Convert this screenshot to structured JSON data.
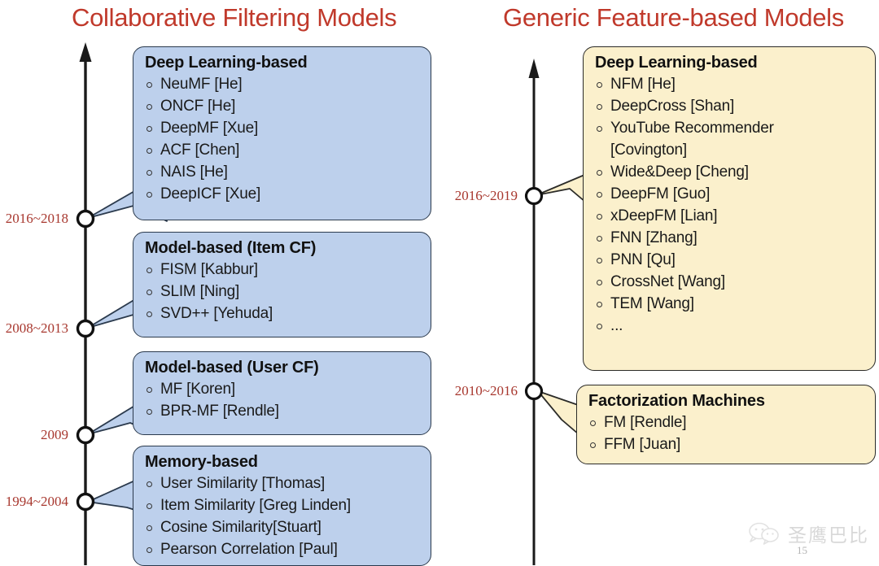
{
  "panels": {
    "left": {
      "title": "Collaborative Filtering Models",
      "years": [
        "2016~2018",
        "2008~2013",
        "2009",
        "1994~2004"
      ],
      "groups": [
        {
          "heading": "Deep Learning-based",
          "items": [
            "NeuMF [He]",
            "ONCF [He]",
            "DeepMF [Xue]",
            "ACF [Chen]",
            "NAIS [He]",
            "DeepICF [Xue]"
          ]
        },
        {
          "heading": "Model-based (Item CF)",
          "items": [
            "FISM [Kabbur]",
            "SLIM [Ning]",
            "SVD++ [Yehuda]"
          ]
        },
        {
          "heading": "Model-based (User CF)",
          "items": [
            "MF [Koren]",
            "BPR-MF [Rendle]"
          ]
        },
        {
          "heading": "Memory-based",
          "items": [
            "User Similarity [Thomas]",
            "Item Similarity [Greg Linden]",
            "Cosine Similarity[Stuart]",
            "Pearson Correlation [Paul]"
          ]
        }
      ]
    },
    "right": {
      "title": "Generic Feature-based Models",
      "years": [
        "2016~2019",
        "2010~2016"
      ],
      "groups": [
        {
          "heading": "Deep Learning-based",
          "items": [
            "NFM [He]",
            "DeepCross [Shan]",
            "YouTube Recommender",
            "[Covington]",
            "Wide&Deep [Cheng]",
            "DeepFM [Guo]",
            "xDeepFM [Lian]",
            "FNN [Zhang]",
            "PNN [Qu]",
            "CrossNet [Wang]",
            "TEM [Wang]",
            "..."
          ]
        },
        {
          "heading": "Factorization Machines",
          "items": [
            "FM [Rendle]",
            "FFM [Juan]"
          ]
        }
      ]
    }
  },
  "watermark": {
    "text": "圣鹰巴比",
    "icon": "wechat-bubbles-icon"
  },
  "page_number": "15",
  "colors": {
    "title": "#C0392B",
    "year_label": "#A8382F",
    "left_box_fill": "#BDD0EC",
    "right_box_fill": "#FBF0CC",
    "axis": "#1a1a1a"
  }
}
